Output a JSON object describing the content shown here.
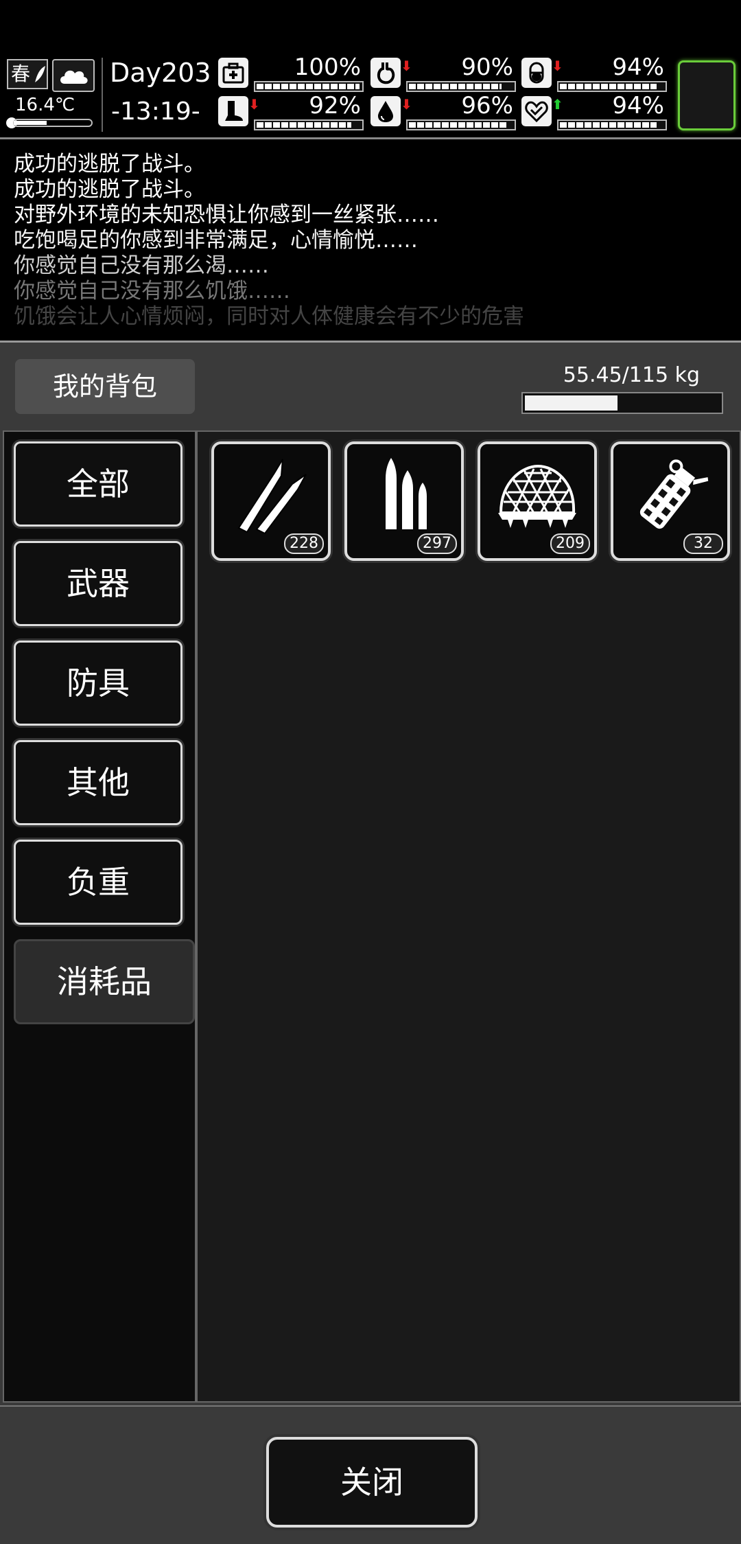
{
  "hud": {
    "season": "春",
    "temperature": "16.4℃",
    "day": "Day203",
    "time": "-13:19-",
    "stats": [
      {
        "icon": "medkit-icon",
        "value": "100%",
        "level": 1.0,
        "arrow": ""
      },
      {
        "icon": "stomach-icon",
        "value": "90%",
        "level": 0.9,
        "arrow": "down"
      },
      {
        "icon": "pill-icon",
        "value": "94%",
        "level": 0.94,
        "arrow": "down"
      },
      {
        "icon": "foot-icon",
        "value": "92%",
        "level": 0.92,
        "arrow": "down"
      },
      {
        "icon": "water-drop-icon",
        "value": "96%",
        "level": 0.96,
        "arrow": "down"
      },
      {
        "icon": "heart-icon",
        "value": "94%",
        "level": 0.94,
        "arrow": "up"
      }
    ],
    "colors": {
      "arrow_down": "#e02020",
      "arrow_up": "#22cc33",
      "avatar_border": "#6acc3a"
    }
  },
  "log": [
    "成功的逃脱了战斗。",
    "成功的逃脱了战斗。",
    "对野外环境的未知恐惧让你感到一丝紧张……",
    "吃饱喝足的你感到非常满足，心情愉悦……",
    "你感觉自己没有那么渴……",
    "你感觉自己没有那么饥饿……",
    "饥饿会让人心情烦闷，同时对人体健康会有不少的危害"
  ],
  "backpack": {
    "title": "我的背包",
    "weight": "55.45/115 kg",
    "weight_fraction": 0.482
  },
  "categories": [
    "全部",
    "武器",
    "防具",
    "其他",
    "负重",
    "消耗品"
  ],
  "active_category": "消耗品",
  "items": [
    {
      "icon": "rifle-bullets-icon",
      "count": "228"
    },
    {
      "icon": "ammo-cartridges-icon",
      "count": "297"
    },
    {
      "icon": "camo-helmet-icon",
      "count": "209"
    },
    {
      "icon": "grenade-icon",
      "count": "32"
    }
  ],
  "close_label": "关闭"
}
